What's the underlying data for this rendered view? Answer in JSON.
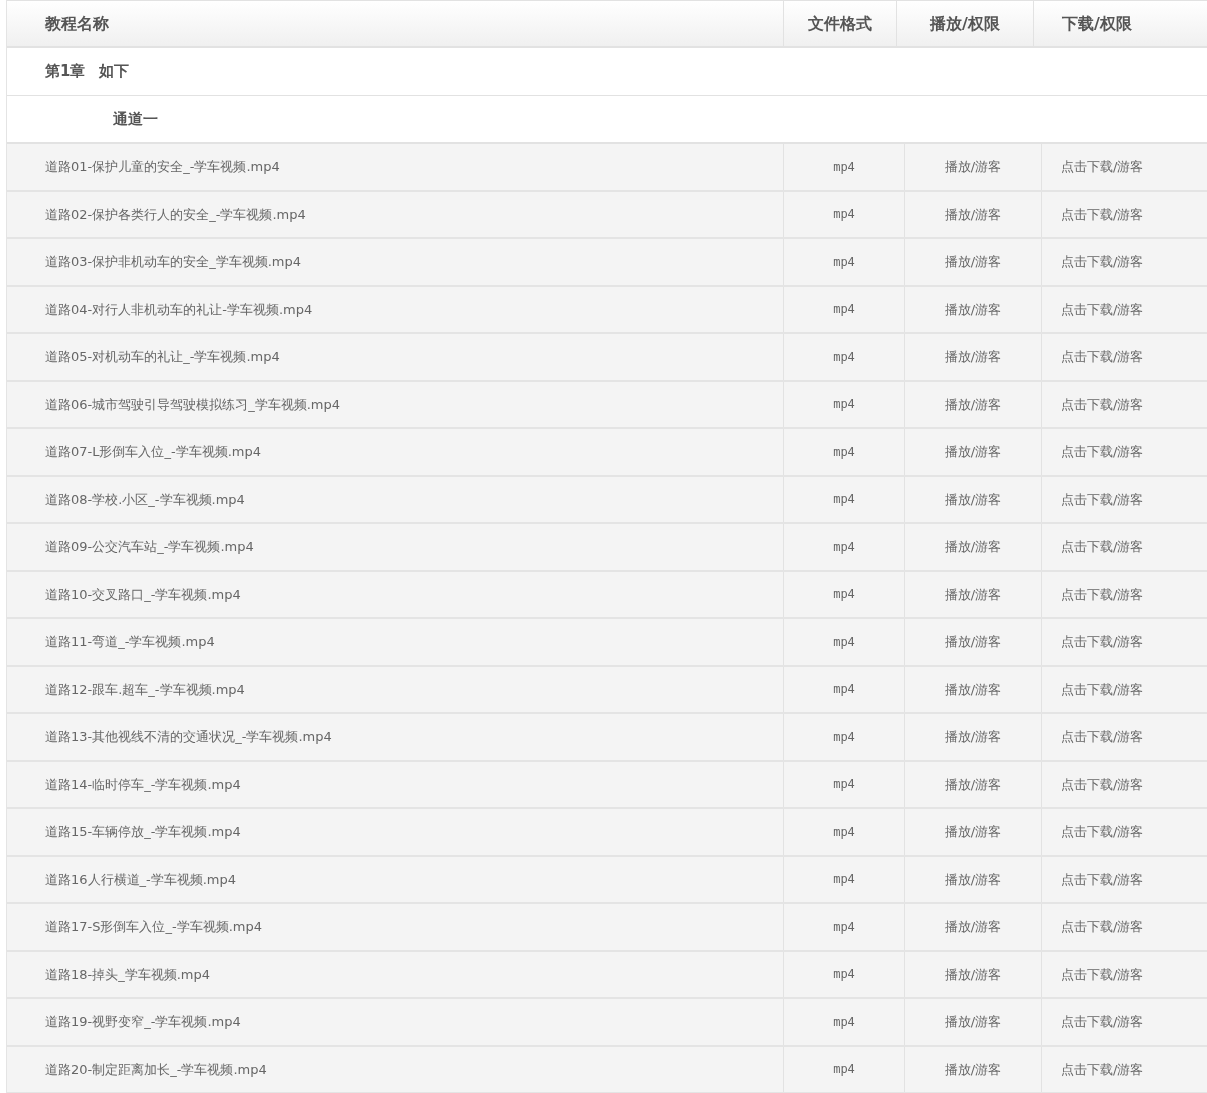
{
  "table": {
    "columns": [
      "教程名称",
      "文件格式",
      "播放/权限",
      "下载/权限"
    ],
    "chapter": {
      "number": "第1章",
      "title": "如下"
    },
    "channel": "通道一",
    "rows": [
      {
        "name": "道路01-保护儿童的安全_-学车视频.mp4",
        "format": "mp4",
        "play": "播放/游客",
        "download": "点击下载/游客"
      },
      {
        "name": "道路02-保护各类行人的安全_-学车视频.mp4",
        "format": "mp4",
        "play": "播放/游客",
        "download": "点击下载/游客"
      },
      {
        "name": "道路03-保护非机动车的安全_学车视频.mp4",
        "format": "mp4",
        "play": "播放/游客",
        "download": "点击下载/游客"
      },
      {
        "name": "道路04-对行人非机动车的礼让-学车视频.mp4",
        "format": "mp4",
        "play": "播放/游客",
        "download": "点击下载/游客"
      },
      {
        "name": "道路05-对机动车的礼让_-学车视频.mp4",
        "format": "mp4",
        "play": "播放/游客",
        "download": "点击下载/游客"
      },
      {
        "name": "道路06-城市驾驶引导驾驶模拟练习_学车视频.mp4",
        "format": "mp4",
        "play": "播放/游客",
        "download": "点击下载/游客"
      },
      {
        "name": "道路07-L形倒车入位_-学车视频.mp4",
        "format": "mp4",
        "play": "播放/游客",
        "download": "点击下载/游客"
      },
      {
        "name": "道路08-学校.小区_-学车视频.mp4",
        "format": "mp4",
        "play": "播放/游客",
        "download": "点击下载/游客"
      },
      {
        "name": "道路09-公交汽车站_-学车视频.mp4",
        "format": "mp4",
        "play": "播放/游客",
        "download": "点击下载/游客"
      },
      {
        "name": "道路10-交叉路口_-学车视频.mp4",
        "format": "mp4",
        "play": "播放/游客",
        "download": "点击下载/游客"
      },
      {
        "name": "道路11-弯道_-学车视频.mp4",
        "format": "mp4",
        "play": "播放/游客",
        "download": "点击下载/游客"
      },
      {
        "name": "道路12-跟车.超车_-学车视频.mp4",
        "format": "mp4",
        "play": "播放/游客",
        "download": "点击下载/游客"
      },
      {
        "name": "道路13-其他视线不清的交通状况_-学车视频.mp4",
        "format": "mp4",
        "play": "播放/游客",
        "download": "点击下载/游客"
      },
      {
        "name": "道路14-临时停车_-学车视频.mp4",
        "format": "mp4",
        "play": "播放/游客",
        "download": "点击下载/游客"
      },
      {
        "name": "道路15-车辆停放_-学车视频.mp4",
        "format": "mp4",
        "play": "播放/游客",
        "download": "点击下载/游客"
      },
      {
        "name": "道路16人行横道_-学车视频.mp4",
        "format": "mp4",
        "play": "播放/游客",
        "download": "点击下载/游客"
      },
      {
        "name": "道路17-S形倒车入位_-学车视频.mp4",
        "format": "mp4",
        "play": "播放/游客",
        "download": "点击下载/游客"
      },
      {
        "name": "道路18-掉头_学车视频.mp4",
        "format": "mp4",
        "play": "播放/游客",
        "download": "点击下载/游客"
      },
      {
        "name": "道路19-视野变窄_-学车视频.mp4",
        "format": "mp4",
        "play": "播放/游客",
        "download": "点击下载/游客"
      },
      {
        "name": "道路20-制定距离加长_-学车视频.mp4",
        "format": "mp4",
        "play": "播放/游客",
        "download": "点击下载/游客"
      }
    ]
  }
}
